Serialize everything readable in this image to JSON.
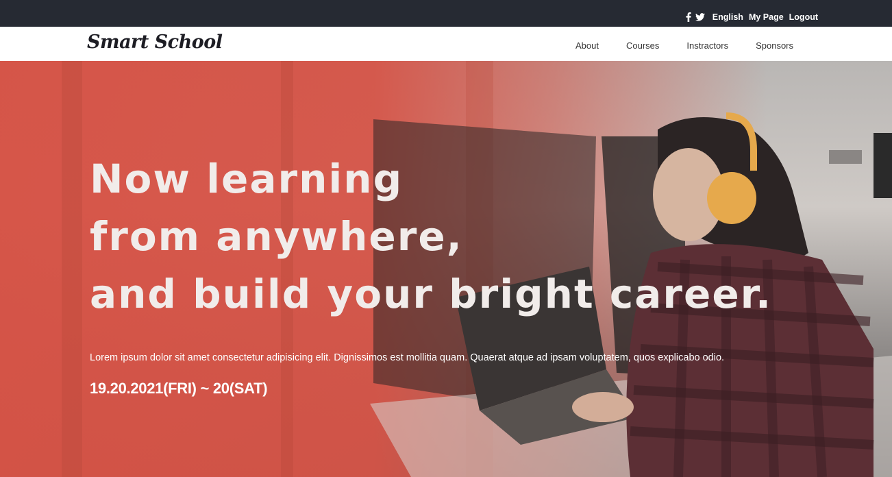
{
  "topbar": {
    "social": [
      "facebook-icon",
      "twitter-icon"
    ],
    "links": [
      "English",
      "My Page",
      "Logout"
    ]
  },
  "brand": {
    "name": "Smart School"
  },
  "nav": {
    "items": [
      "About",
      "Courses",
      "Instractors",
      "Sponsors"
    ]
  },
  "hero": {
    "headline": [
      "Now learning",
      "from anywhere,",
      "and build your bright career."
    ],
    "description": "Lorem ipsum dolor sit amet consectetur adipisicing elit. Dignissimos est mollitia quam. Quaerat atque ad ipsam voluptatem, quos explicabo odio.",
    "date": "19.20.2021(FRI) ~ 20(SAT)"
  },
  "colors": {
    "topbar": "#262a33",
    "navbar": "#ffffff",
    "hero_overlay": "#d65245",
    "text_light": "#ffffff"
  }
}
